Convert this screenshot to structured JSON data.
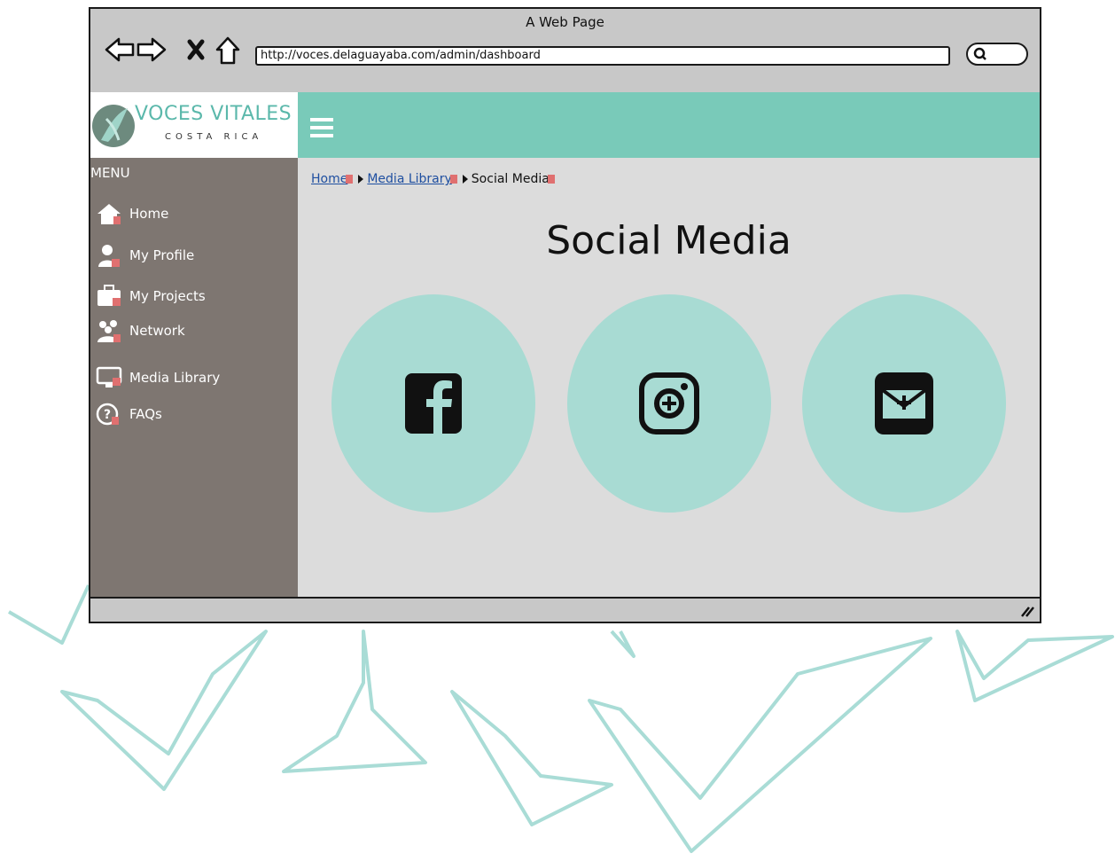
{
  "browser": {
    "title": "A Web Page",
    "url": "http://voces.delaguayaba.com/admin/dashboard"
  },
  "logo": {
    "name": "VOCES VITALES",
    "subtitle": "COSTA RICA"
  },
  "sidebar": {
    "title": "MENU",
    "items": [
      {
        "label": "Home",
        "icon": "home-icon"
      },
      {
        "label": "My Profile",
        "icon": "user-icon"
      },
      {
        "label": "My Projects",
        "icon": "briefcase-icon"
      },
      {
        "label": "Network",
        "icon": "people-icon"
      },
      {
        "label": "Media Library",
        "icon": "monitor-icon"
      },
      {
        "label": "FAQs",
        "icon": "help-icon"
      }
    ]
  },
  "breadcrumb": {
    "items": [
      "Home",
      "Media Library",
      "Social Media"
    ]
  },
  "main": {
    "title": "Social Media",
    "social": [
      {
        "name": "facebook",
        "icon": "facebook-icon"
      },
      {
        "name": "instagram",
        "icon": "instagram-icon"
      },
      {
        "name": "email",
        "icon": "email-icon"
      }
    ]
  },
  "colors": {
    "header": "#79cab9",
    "sidebar": "#7e7671",
    "content": "#dcdcdc",
    "circle": "#a8dbd3"
  }
}
